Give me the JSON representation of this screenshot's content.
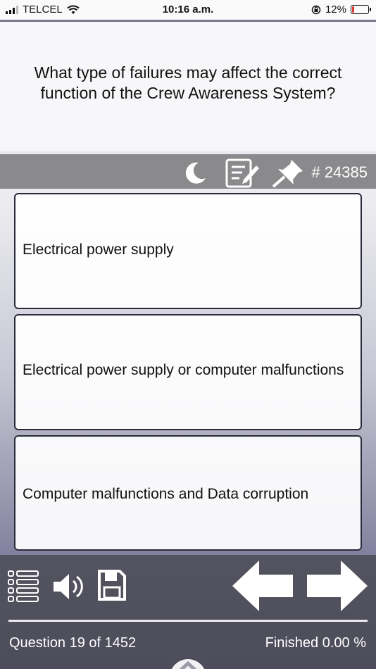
{
  "status_bar": {
    "carrier": "TELCEL",
    "time": "10:16 a.m.",
    "battery_percent": "12%",
    "battery_level": 0.12,
    "battery_color": "#e23b2f"
  },
  "question": {
    "text": "What type of failures may affect the correct function of the Crew Awareness System?"
  },
  "toolbar": {
    "icons": [
      "moon-icon",
      "notes-icon",
      "pin-icon"
    ],
    "question_id": "# 24385"
  },
  "answers": [
    {
      "label": "Electrical power supply"
    },
    {
      "label": "Electrical power supply or computer malfunctions"
    },
    {
      "label": "Computer malfunctions and Data corruption"
    }
  ],
  "bottom_bar": {
    "icons": [
      "list-icon",
      "speaker-icon",
      "save-icon",
      "previous-arrow-icon",
      "next-arrow-icon",
      "chevron-up-icon"
    ],
    "progress": "Question 19 of 1452",
    "finished": "Finished 0.00 %"
  },
  "colors": {
    "toolbar": "#8a8a8c",
    "answer_border": "#2b2b3c",
    "bottom_bar": "#48484f"
  }
}
